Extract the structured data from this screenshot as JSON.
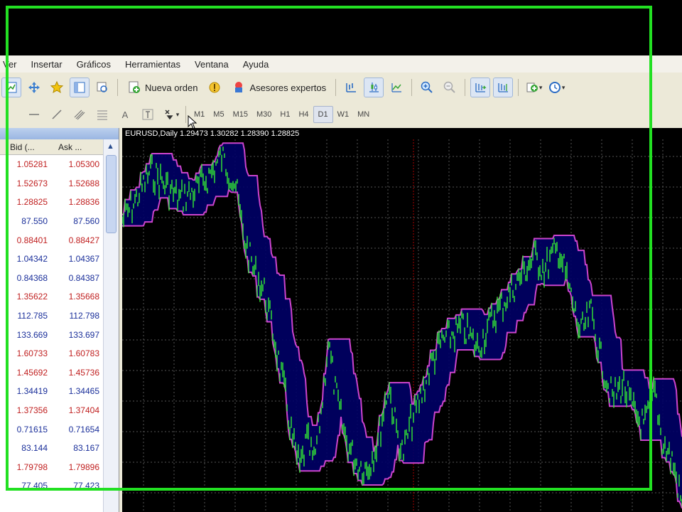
{
  "menu": [
    "Ver",
    "Insertar",
    "Gráficos",
    "Herramientas",
    "Ventana",
    "Ayuda"
  ],
  "toolbar": {
    "new_order": "Nueva orden",
    "experts": "Asesores expertos",
    "text_tool": "A"
  },
  "periods": [
    "M1",
    "M5",
    "M15",
    "M30",
    "H1",
    "H4",
    "D1",
    "W1",
    "MN"
  ],
  "active_period": "D1",
  "market_watch": {
    "col_bid": "Bid (...",
    "col_ask": "Ask ...",
    "rows": [
      {
        "bid": "1.05281",
        "ask": "1.05300",
        "color": "red"
      },
      {
        "bid": "1.52673",
        "ask": "1.52688",
        "color": "red"
      },
      {
        "bid": "1.28825",
        "ask": "1.28836",
        "color": "red"
      },
      {
        "bid": "87.550",
        "ask": "87.560",
        "color": "blue"
      },
      {
        "bid": "0.88401",
        "ask": "0.88427",
        "color": "red"
      },
      {
        "bid": "1.04342",
        "ask": "1.04367",
        "color": "blue"
      },
      {
        "bid": "0.84368",
        "ask": "0.84387",
        "color": "blue"
      },
      {
        "bid": "1.35622",
        "ask": "1.35668",
        "color": "red"
      },
      {
        "bid": "112.785",
        "ask": "112.798",
        "color": "blue"
      },
      {
        "bid": "133.669",
        "ask": "133.697",
        "color": "blue"
      },
      {
        "bid": "1.60733",
        "ask": "1.60783",
        "color": "red"
      },
      {
        "bid": "1.45692",
        "ask": "1.45736",
        "color": "red"
      },
      {
        "bid": "1.34419",
        "ask": "1.34465",
        "color": "blue"
      },
      {
        "bid": "1.37356",
        "ask": "1.37404",
        "color": "red"
      },
      {
        "bid": "0.71615",
        "ask": "0.71654",
        "color": "blue"
      },
      {
        "bid": "83.144",
        "ask": "83.167",
        "color": "blue"
      },
      {
        "bid": "1.79798",
        "ask": "1.79896",
        "color": "red"
      },
      {
        "bid": "77.405",
        "ask": "77.423",
        "color": "blue"
      }
    ]
  },
  "chart": {
    "title": "EURUSD,Daily  1.29473 1.30282 1.28390 1.28825"
  },
  "colors": {
    "price": "#33ee33",
    "channel": "#cc44cc",
    "fill": "#000066",
    "grid": "#555555",
    "frame": "#22e022"
  }
}
